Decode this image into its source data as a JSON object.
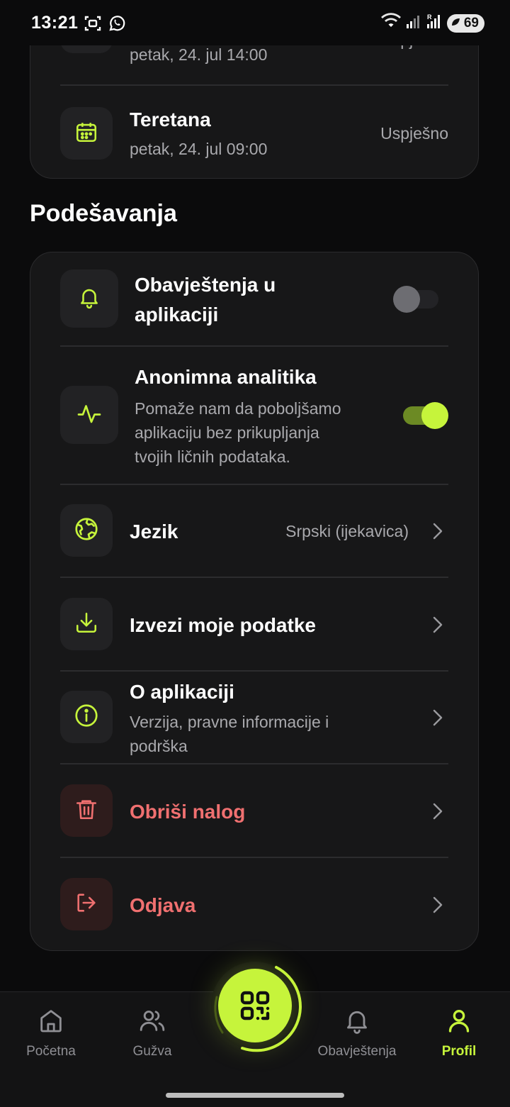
{
  "status_bar": {
    "time": "13:21",
    "battery": "69",
    "icons": [
      "screenshot-icon",
      "whatsapp-icon",
      "wifi-icon",
      "signal-icon",
      "signal-roaming-icon",
      "battery-icon"
    ]
  },
  "history": {
    "items": [
      {
        "title": "",
        "subtitle": "petak, 24. jul 14:00",
        "status": "Uspješno",
        "icon": "calendar-icon"
      },
      {
        "title": "Teretana",
        "subtitle": "petak, 24. jul 09:00",
        "status": "Uspješno",
        "icon": "calendar-icon"
      }
    ]
  },
  "settings": {
    "section_title": "Podešavanja",
    "notifications": {
      "title_line1": "Obavještenja u",
      "title_line2": "aplikaciji",
      "enabled": false,
      "icon": "bell-icon"
    },
    "analytics": {
      "title": "Anonimna analitika",
      "desc_line1": "Pomaže nam da poboljšamo",
      "desc_line2": "aplikaciju bez prikupljanja",
      "desc_line3": "tvojih ličnih podataka.",
      "enabled": true,
      "icon": "activity-icon"
    },
    "language": {
      "title": "Jezik",
      "value": "Srpski (ijekavica)",
      "icon": "globe-icon"
    },
    "export": {
      "title": "Izvezi moje podatke",
      "icon": "download-icon"
    },
    "about": {
      "title": "O aplikaciji",
      "desc_line1": "Verzija, pravne informacije i",
      "desc_line2": "podrška",
      "icon": "info-icon"
    },
    "delete": {
      "title": "Obriši nalog",
      "icon": "trash-icon"
    },
    "logout": {
      "title": "Odjava",
      "icon": "logout-icon"
    }
  },
  "nav": {
    "items": [
      {
        "label": "Početna",
        "icon": "home-icon"
      },
      {
        "label": "Gužva",
        "icon": "users-icon"
      },
      {
        "label": "Obavještenja",
        "icon": "bell-icon"
      },
      {
        "label": "Profil",
        "icon": "user-icon",
        "active": true
      }
    ],
    "fab_icon": "qr-code-icon"
  },
  "colors": {
    "accent": "#c6f43b",
    "danger": "#f07070",
    "background": "#0b0b0c",
    "card": "#171718",
    "muted": "#a9a9ad"
  }
}
